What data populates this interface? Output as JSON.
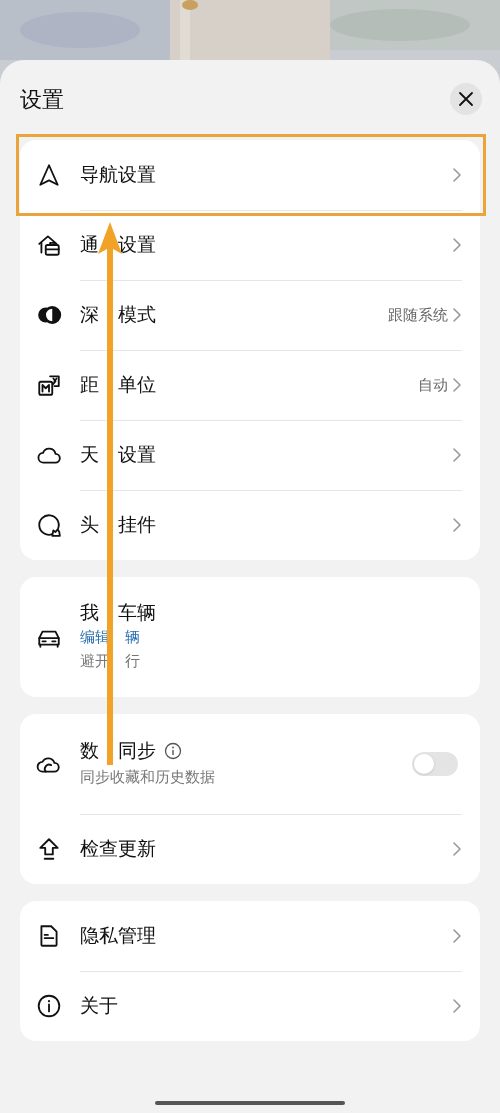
{
  "title": "设置",
  "groups": [
    {
      "items": [
        {
          "kind": "link",
          "label": [
            "导航设置"
          ],
          "highlighted": true
        },
        {
          "kind": "link",
          "label": [
            "通",
            "设置"
          ],
          "highlighted": false
        },
        {
          "kind": "link",
          "label": [
            "深",
            "模式"
          ],
          "value": "跟随系统",
          "highlighted": false
        },
        {
          "kind": "link",
          "label": [
            "距",
            "单位"
          ],
          "value": "自动",
          "highlighted": false
        },
        {
          "kind": "link",
          "label": [
            "天",
            "设置"
          ],
          "highlighted": false
        },
        {
          "kind": "link",
          "label": [
            "头",
            "挂件"
          ],
          "highlighted": false
        }
      ]
    },
    {
      "items": [
        {
          "kind": "vehicle",
          "label": [
            "我",
            "车辆"
          ],
          "link": [
            "编辑",
            "辆"
          ],
          "subtitle": [
            "避开",
            "行"
          ]
        }
      ]
    },
    {
      "items": [
        {
          "kind": "toggle",
          "label": [
            "数",
            "同步"
          ],
          "subtitle": [
            "同步收藏和历史数据"
          ],
          "on": false
        },
        {
          "kind": "link",
          "label": [
            "检查更新"
          ],
          "highlighted": false
        }
      ]
    },
    {
      "items": [
        {
          "kind": "link",
          "label": [
            "隐私管理"
          ],
          "highlighted": false
        },
        {
          "kind": "link",
          "label": [
            "关于"
          ],
          "highlighted": false
        }
      ]
    }
  ]
}
